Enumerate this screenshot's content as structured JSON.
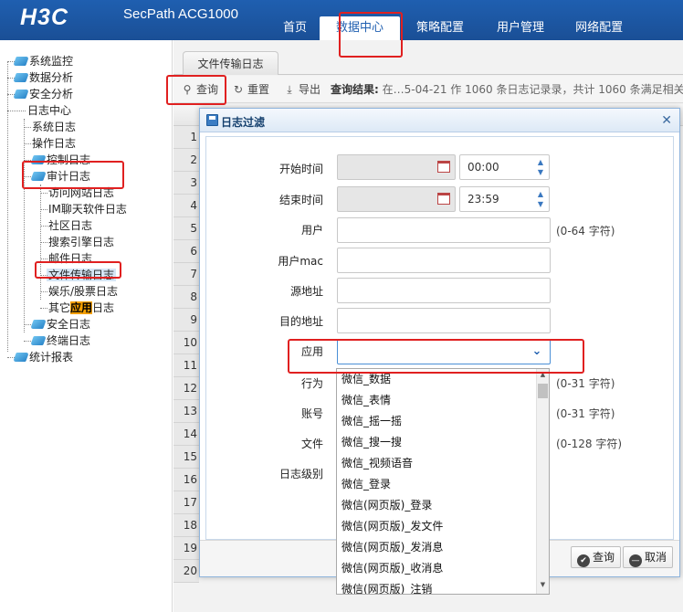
{
  "header": {
    "logo": "H3C",
    "product": "SecPath ACG1000",
    "nav": [
      "首页",
      "数据中心",
      "策略配置",
      "用户管理",
      "网络配置"
    ],
    "active_nav": "数据中心"
  },
  "sidebar": {
    "items": [
      {
        "label": "系统监控"
      },
      {
        "label": "数据分析"
      },
      {
        "label": "安全分析"
      },
      {
        "label": "日志中心"
      },
      {
        "label": "系统日志"
      },
      {
        "label": "操作日志"
      },
      {
        "label": "控制日志"
      },
      {
        "label": "审计日志"
      },
      {
        "label": "访问网站日志"
      },
      {
        "label": "IM聊天软件日志"
      },
      {
        "label": "社区日志"
      },
      {
        "label": "搜索引擎日志"
      },
      {
        "label": "邮件日志"
      },
      {
        "label": "文件传输日志"
      },
      {
        "label": "娱乐/股票日志"
      },
      {
        "label_pre": "其它",
        "label_hl": "应用",
        "label_post": "日志"
      },
      {
        "label": "安全日志"
      },
      {
        "label": "终端日志"
      },
      {
        "label": "统计报表"
      }
    ]
  },
  "main": {
    "tab": "文件传输日志",
    "toolbar": {
      "query": "查询",
      "reset": "重置",
      "export": "导出",
      "result_label": "查询结果:",
      "result_text": "在…5-04-21 作 1060 条日志记录录，共计 1060 条满足相关条件"
    },
    "row_numbers": [
      "1",
      "2",
      "3",
      "4",
      "5",
      "6",
      "7",
      "8",
      "9",
      "10",
      "11",
      "12",
      "13",
      "14",
      "15",
      "16",
      "17",
      "18",
      "19",
      "20"
    ]
  },
  "dialog": {
    "title": "日志过滤",
    "start_time_label": "开始时间",
    "start_time_value": "00:00",
    "end_time_label": "结束时间",
    "end_time_value": "23:59",
    "user_label": "用户",
    "user_hint": "(0-64 字符)",
    "mac_label": "用户mac",
    "src_label": "源地址",
    "dst_label": "目的地址",
    "app_label": "应用",
    "action_label": "行为",
    "action_hint": "(0-31 字符)",
    "account_label": "账号",
    "account_hint": "(0-31 字符)",
    "file_label": "文件",
    "file_hint": "(0-128 字符)",
    "level_label": "日志级别",
    "query_button": "查询",
    "cancel_button": "取消",
    "app_options": [
      "微信_数据",
      "微信_表情",
      "微信_摇一摇",
      "微信_搜一搜",
      "微信_视频语音",
      "微信_登录",
      "微信(网页版)_登录",
      "微信(网页版)_发文件",
      "微信(网页版)_发消息",
      "微信(网页版)_收消息",
      "微信(网页版)_注销"
    ]
  },
  "colors": {
    "header_blue": "#1f5fb0",
    "annotation_red": "#e02020",
    "highlight_orange": "#f5a000"
  }
}
